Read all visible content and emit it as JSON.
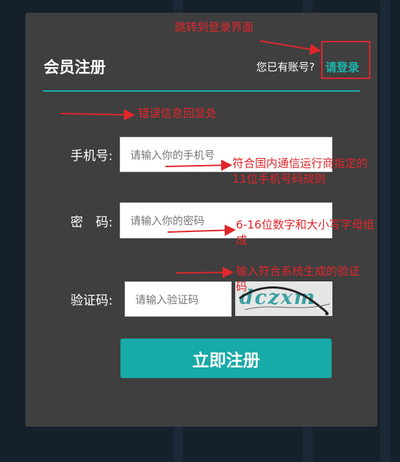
{
  "form": {
    "title": "会员注册",
    "has_account": "您已有账号?",
    "login_link": "请登录",
    "phone_label": "手机号:",
    "phone_placeholder": "请输入你的手机号",
    "password_label": "密　码:",
    "password_placeholder": "请输入你的密码",
    "captcha_label": "验证码:",
    "captcha_placeholder": "请输入验证码",
    "captcha_text": "dczxm",
    "submit_label": "立即注册"
  },
  "annotations": {
    "login": "跳转到登录界面",
    "error": "错误信息回显处",
    "phone": "符合国内通信运行商指定的11位手机号码规则",
    "password": "6-16位数字和大小写字母组成",
    "captcha": "输入符合系统生成的验证码"
  },
  "colors": {
    "background": "#16202b",
    "panel": "#3f3f3f",
    "accent": "#17aaa8",
    "annotation": "#e0262b"
  }
}
